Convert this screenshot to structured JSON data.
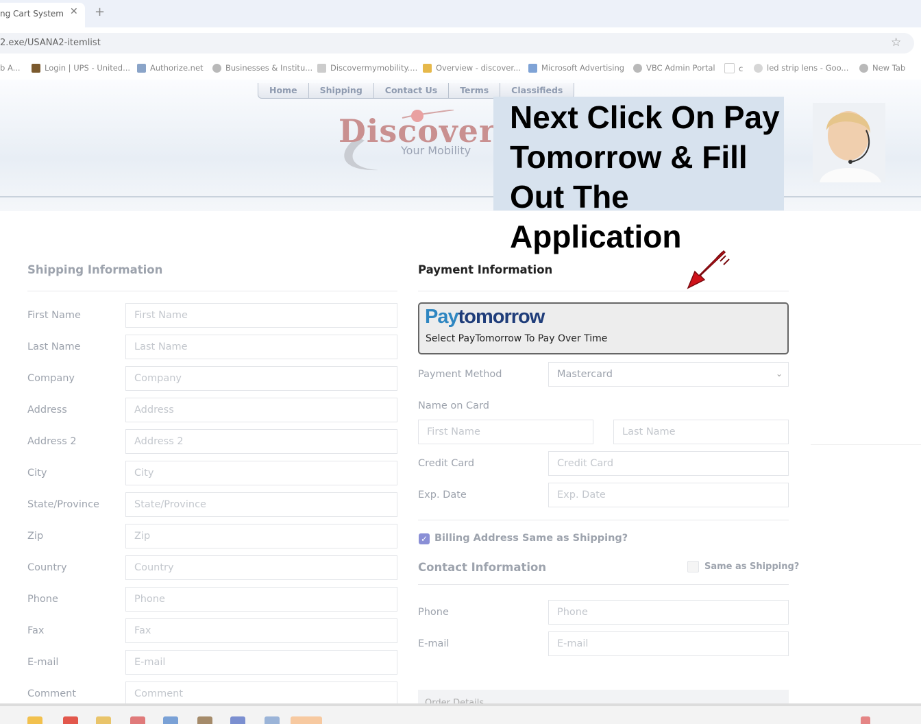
{
  "browser": {
    "tab_title": "ng Cart System",
    "tab_close": "✕",
    "new_tab": "+",
    "address": "2.exe/USANA2-itemlist",
    "star": "☆",
    "bookmarks": [
      {
        "label": "b A..."
      },
      {
        "label": "Login | UPS - United..."
      },
      {
        "label": "Authorize.net"
      },
      {
        "label": "Businesses & Institu..."
      },
      {
        "label": "Discovermymobility...."
      },
      {
        "label": "Overview - discover..."
      },
      {
        "label": "Microsoft Advertising"
      },
      {
        "label": "VBC Admin Portal"
      },
      {
        "label": "c"
      },
      {
        "label": "led strip lens - Goo..."
      },
      {
        "label": "New Tab"
      }
    ]
  },
  "site": {
    "nav": [
      "Home",
      "Shipping",
      "Contact Us",
      "Terms",
      "Classifieds"
    ],
    "logo_main": "Discover",
    "logo_sub": "Your Mobility",
    "instruction": "Next Click On Pay Tomorrow & Fill Out The Application"
  },
  "shipping": {
    "title": "Shipping Information",
    "fields": [
      {
        "label": "First Name",
        "placeholder": "First Name"
      },
      {
        "label": "Last Name",
        "placeholder": "Last Name"
      },
      {
        "label": "Company",
        "placeholder": "Company"
      },
      {
        "label": "Address",
        "placeholder": "Address"
      },
      {
        "label": "Address 2",
        "placeholder": "Address 2"
      },
      {
        "label": "City",
        "placeholder": "City"
      },
      {
        "label": "State/Province",
        "placeholder": "State/Province"
      },
      {
        "label": "Zip",
        "placeholder": "Zip"
      },
      {
        "label": "Country",
        "placeholder": "Country"
      },
      {
        "label": "Phone",
        "placeholder": "Phone"
      },
      {
        "label": "Fax",
        "placeholder": "Fax"
      },
      {
        "label": "E-mail",
        "placeholder": "E-mail"
      },
      {
        "label": "Comment",
        "placeholder": "Comment"
      }
    ]
  },
  "payment": {
    "title": "Payment Information",
    "paytomorrow_logo_a": "Pay",
    "paytomorrow_logo_b": "tomorrow",
    "paytomorrow_caption": "Select PayTomorrow To Pay Over Time",
    "method_label": "Payment Method",
    "method_value": "Mastercard",
    "name_on_card_label": "Name on Card",
    "first_name_placeholder": "First Name",
    "last_name_placeholder": "Last Name",
    "credit_card_label": "Credit Card",
    "credit_card_placeholder": "Credit Card",
    "exp_label": "Exp. Date",
    "exp_placeholder": "Exp. Date",
    "billing_same_label": "Billing Address Same as Shipping?",
    "billing_same_checked": true
  },
  "contact": {
    "title": "Contact Information",
    "same_label": "Same as Shipping?",
    "phone_label": "Phone",
    "phone_placeholder": "Phone",
    "email_label": "E-mail",
    "email_placeholder": "E-mail"
  },
  "order": {
    "partial_title": "Order Details"
  },
  "colors": {
    "paytomorrow_blue": "#2e86c1",
    "paytomorrow_navy": "#1f3d7a",
    "checkbox_accent": "#8a8fd6",
    "arrow_red": "#d0121a"
  }
}
